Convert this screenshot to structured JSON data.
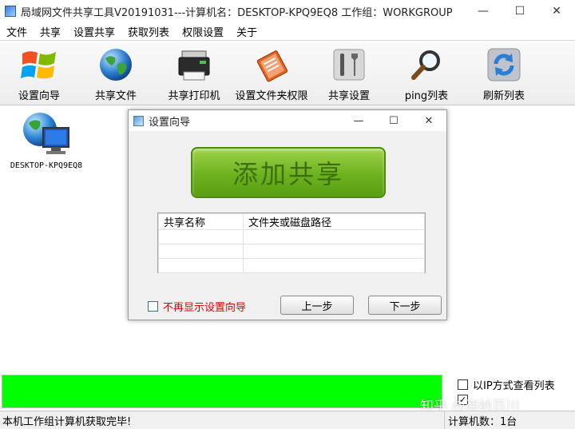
{
  "window": {
    "title": "局域网文件共享工具V20191031---计算机名：DESKTOP-KPQ9EQ8  工作组：WORKGROUP",
    "minimize": "—",
    "maximize": "☐",
    "close": "✕"
  },
  "menu": [
    "文件",
    "共享",
    "设置共享",
    "获取列表",
    "权限设置",
    "关于"
  ],
  "toolbar": [
    {
      "label": "设置向导",
      "icon": "windows-logo-icon"
    },
    {
      "label": "共享文件",
      "icon": "globe-icon"
    },
    {
      "label": "共享打印机",
      "icon": "printer-icon"
    },
    {
      "label": "设置文件夹权限",
      "icon": "folder-permission-icon"
    },
    {
      "label": "共享设置",
      "icon": "tools-icon"
    },
    {
      "label": "ping列表",
      "icon": "magnifier-icon"
    },
    {
      "label": "刷新列表",
      "icon": "refresh-icon"
    }
  ],
  "computers": [
    {
      "name": "DESKTOP-KPQ9EQ8"
    }
  ],
  "dialog": {
    "title": "设置向导",
    "minimize": "—",
    "maximize": "☐",
    "close": "✕",
    "add_share_label": "添加共享",
    "table": {
      "headers": [
        "共享名称",
        "文件夹或磁盘路径"
      ],
      "rows": []
    },
    "dont_show_label": "不再显示设置向导",
    "prev_label": "上一步",
    "next_label": "下一步"
  },
  "options": {
    "ip_view_label": "以IP方式查看列表"
  },
  "progress": {
    "value": 1.0,
    "color": "#00ff00"
  },
  "status": {
    "message": "本机工作组计算机获取完毕!",
    "count": "计算机数：1台"
  },
  "watermark": "知乎 @海纳百川"
}
